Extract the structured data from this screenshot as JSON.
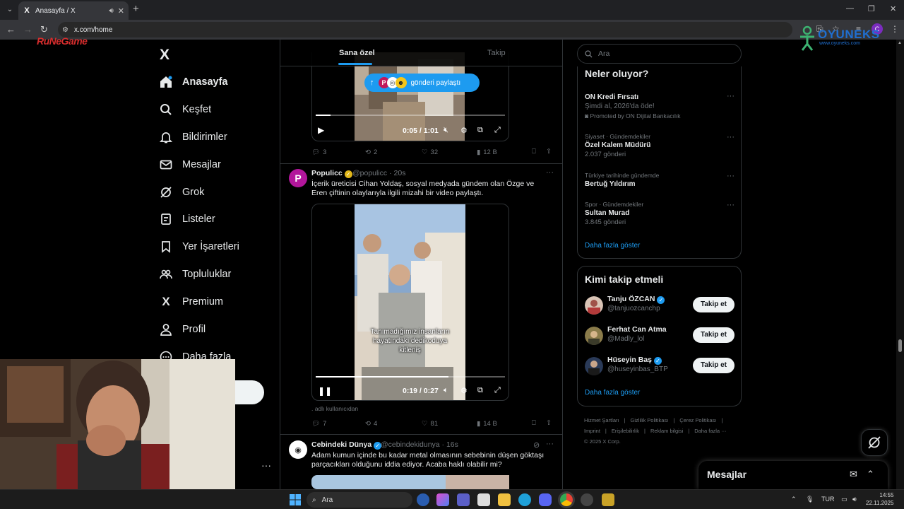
{
  "browser": {
    "tab_title": "Anasayfa / X",
    "tab_favicon": "X",
    "url": "x.com/home",
    "profile_initial": "C",
    "new_tab": "+",
    "window_controls": [
      "—",
      "❐",
      "✕"
    ]
  },
  "overlay_logos": {
    "left": "RuNeGame",
    "right_title": "OYUNEKS",
    "right_sub": "www.oyuneks.com"
  },
  "nav": {
    "logo": "X",
    "items": [
      {
        "label": "Anasayfa",
        "icon": "home-icon"
      },
      {
        "label": "Keşfet",
        "icon": "search-icon"
      },
      {
        "label": "Bildirimler",
        "icon": "bell-icon"
      },
      {
        "label": "Mesajlar",
        "icon": "mail-icon"
      },
      {
        "label": "Grok",
        "icon": "grok-icon"
      },
      {
        "label": "Listeler",
        "icon": "list-icon"
      },
      {
        "label": "Yer İşaretleri",
        "icon": "bookmark-icon"
      },
      {
        "label": "Topluluklar",
        "icon": "community-icon"
      },
      {
        "label": "Premium",
        "icon": "x-premium-icon"
      },
      {
        "label": "Profil",
        "icon": "profile-icon"
      },
      {
        "label": "Daha fazla",
        "icon": "more-icon"
      }
    ],
    "post_button_visible": "a",
    "more_dots": "···"
  },
  "feed": {
    "tabs": [
      "Sana özel",
      "Takip"
    ],
    "new_posts_pill": "gönderi paylaştı",
    "video1": {
      "time": "0:05 / 1:01",
      "progress": 0.08,
      "stats": {
        "replies": "3",
        "reposts": "2",
        "likes": "32",
        "views": "12 B"
      }
    },
    "tweet2": {
      "avatar_letter": "P",
      "name": "Populicc",
      "handle": "@populicc · 20s",
      "text": "İçerik üreticisi Cihan Yoldaş, sosyal medyada gündem olan Özge ve Eren çiftinin olaylarıyla ilgili mizahi bir video paylaştı.",
      "video_caption": "Tanımadığımız insanların hayatındaki dedikoduya kitleniş",
      "time": "0:19 / 0:27",
      "progress": 0.7,
      "source": ". adlı kullanıcıdan",
      "stats": {
        "replies": "7",
        "reposts": "4",
        "likes": "81",
        "views": "14 B"
      }
    },
    "tweet3": {
      "name": "Cebindeki Dünya",
      "handle": "@cebindekidunya · 16s",
      "text": "Adam kumun içinde bu kadar metal olmasının sebebinin düşen göktaşı parçacıkları olduğunu iddia ediyor. Acaba haklı olabilir mi?"
    }
  },
  "sidebar": {
    "search_placeholder": "Ara",
    "trends_title": "Neler oluyor?",
    "trends": [
      {
        "meta": "",
        "name": "ON Kredi Fırsatı",
        "sub": "Şimdi al, 2026'da öde!",
        "extra": "Promoted by ON Dijital Bankacılık"
      },
      {
        "meta": "Siyaset · Gündemdekiler",
        "name": "Özel Kalem Müdürü",
        "sub": "2.037 gönderi",
        "extra": ""
      },
      {
        "meta": "Türkiye tarihinde gündemde",
        "name": "Bertuğ Yıldırım",
        "sub": "",
        "extra": ""
      },
      {
        "meta": "Spor · Gündemdekiler",
        "name": "Sultan Murad",
        "sub": "3.845 gönderi",
        "extra": ""
      }
    ],
    "show_more": "Daha fazla göster",
    "wtf_title": "Kimi takip etmeli",
    "wtf": [
      {
        "name": "Tanju ÖZCAN",
        "handle": "@tanjuozcanchp",
        "button": "Takip et",
        "verified": true
      },
      {
        "name": "Ferhat Can Atma",
        "handle": "@Madly_lol",
        "button": "Takip et",
        "verified": false
      },
      {
        "name": "Hüseyin Baş",
        "handle": "@huseyinbas_BTP",
        "button": "Takip et",
        "verified": true
      }
    ],
    "wtf_show_more": "Daha fazla göster",
    "footer": [
      "Hizmet Şartları",
      "|",
      "Gizlilik Politikası",
      "|",
      "Çerez Politikası",
      "|",
      "Imprint",
      "|",
      "Erişilebilirlik",
      "|",
      "Reklam bilgisi",
      "|",
      "Daha fazla ···",
      "© 2025 X Corp."
    ]
  },
  "messages_dock": {
    "label": "Mesajlar"
  },
  "taskbar": {
    "search_label": "Ara",
    "language": "TUR",
    "time": "14:55",
    "date": "22.11.2025"
  },
  "colors": {
    "accent": "#1d9bf0",
    "border": "#2f3336",
    "muted": "#71767b",
    "gold_badge": "#e2b719"
  }
}
